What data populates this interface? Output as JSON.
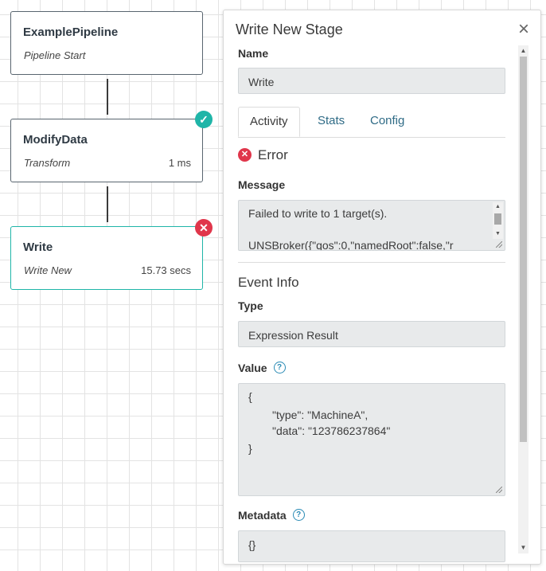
{
  "pipeline": {
    "nodes": [
      {
        "title": "ExamplePipeline",
        "subtitle": "Pipeline Start",
        "time": "",
        "status": "none"
      },
      {
        "title": "ModifyData",
        "subtitle": "Transform",
        "time": "1 ms",
        "status": "success"
      },
      {
        "title": "Write",
        "subtitle": "Write New",
        "time": "15.73 secs",
        "status": "error"
      }
    ]
  },
  "panel": {
    "title": "Write New Stage",
    "name_label": "Name",
    "name_value": "Write",
    "tabs": [
      "Activity",
      "Stats",
      "Config"
    ],
    "active_tab": "Activity",
    "status_text": "Error",
    "message_label": "Message",
    "message_lines": [
      "Failed to write to 1 target(s).",
      "UNSBroker({\"qos\":0,\"namedRoot\":false,\"r"
    ],
    "event_info_title": "Event Info",
    "type_label": "Type",
    "type_value": "Expression Result",
    "value_label": "Value",
    "value_lines": [
      "{",
      "\"type\": \"MachineA\",",
      "\"data\": \"123786237864\"",
      "}"
    ],
    "metadata_label": "Metadata",
    "metadata_value": "{}"
  },
  "colors": {
    "success": "#1fb5a8",
    "error": "#e0364b",
    "link": "#2f6b86"
  },
  "icons": {
    "close": "close-icon",
    "success": "check-icon",
    "error": "x-icon",
    "help": "help-icon"
  }
}
